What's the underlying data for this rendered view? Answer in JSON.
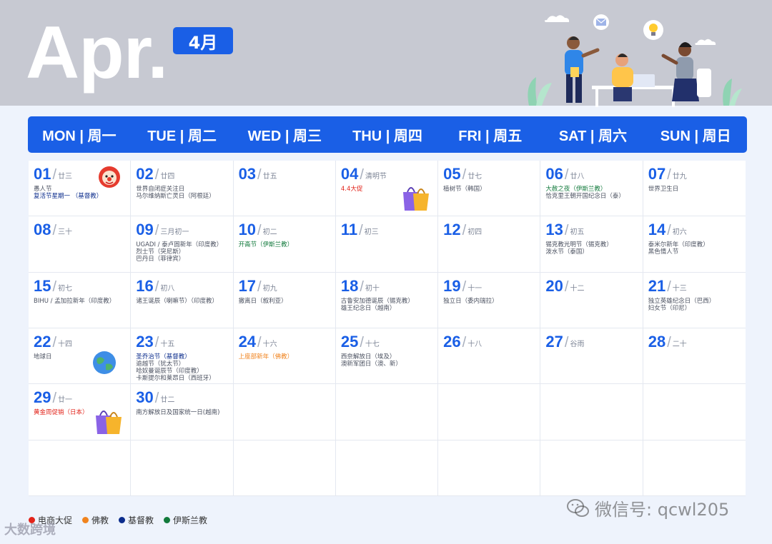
{
  "header": {
    "month_en": "Apr.",
    "month_cn": "4月"
  },
  "weekdays": [
    "MON | 周一",
    "TUE | 周二",
    "WED | 周三",
    "THU | 周四",
    "FRI | 周五",
    "SAT | 周六",
    "SUN | 周日"
  ],
  "days": [
    {
      "num": "01",
      "lunar": "廿三",
      "events": [
        {
          "t": "愚人节",
          "c": ""
        },
        {
          "t": "复活节星期一 （基督教）",
          "c": "blue"
        }
      ],
      "deco": "clown-icon"
    },
    {
      "num": "02",
      "lunar": "廿四",
      "events": [
        {
          "t": "世界自闭症关注日",
          "c": ""
        },
        {
          "t": "马尔维纳斯亡灵日（阿根廷）",
          "c": ""
        }
      ]
    },
    {
      "num": "03",
      "lunar": "廿五",
      "events": []
    },
    {
      "num": "04",
      "lunar": "清明节",
      "events": [
        {
          "t": "4.4大促",
          "c": "red"
        }
      ],
      "deco": "shopping-bag-icon"
    },
    {
      "num": "05",
      "lunar": "廿七",
      "events": [
        {
          "t": "植树节（韩国）",
          "c": ""
        }
      ]
    },
    {
      "num": "06",
      "lunar": "廿八",
      "events": [
        {
          "t": "大赦之夜（伊斯兰教）",
          "c": "green"
        },
        {
          "t": "恰克里王朝开国纪念日（泰）",
          "c": ""
        }
      ]
    },
    {
      "num": "07",
      "lunar": "廿九",
      "events": [
        {
          "t": "世界卫生日",
          "c": ""
        }
      ]
    },
    {
      "num": "08",
      "lunar": "三十",
      "events": []
    },
    {
      "num": "09",
      "lunar": "三月初一",
      "events": [
        {
          "t": "UGADI / 泰卢固新年（印度教）",
          "c": ""
        },
        {
          "t": "烈士节（突尼斯）",
          "c": ""
        },
        {
          "t": "巴丹日（菲律宾）",
          "c": ""
        }
      ]
    },
    {
      "num": "10",
      "lunar": "初二",
      "events": [
        {
          "t": "开斋节（伊斯兰教）",
          "c": "green"
        }
      ]
    },
    {
      "num": "11",
      "lunar": "初三",
      "events": []
    },
    {
      "num": "12",
      "lunar": "初四",
      "events": []
    },
    {
      "num": "13",
      "lunar": "初五",
      "events": [
        {
          "t": "锡克教光明节（锡克教）",
          "c": ""
        },
        {
          "t": "泼水节（泰国）",
          "c": ""
        }
      ]
    },
    {
      "num": "14",
      "lunar": "初六",
      "events": [
        {
          "t": "泰米尔新年（印度教）",
          "c": ""
        },
        {
          "t": "黑色情人节",
          "c": ""
        }
      ]
    },
    {
      "num": "15",
      "lunar": "初七",
      "events": [
        {
          "t": "BIHU / 孟加拉新年（印度教）",
          "c": ""
        }
      ]
    },
    {
      "num": "16",
      "lunar": "初八",
      "events": [
        {
          "t": "诸王诞辰（喇嘛节）（印度教）",
          "c": ""
        }
      ]
    },
    {
      "num": "17",
      "lunar": "初九",
      "events": [
        {
          "t": "撤离日（叙利亚）",
          "c": ""
        }
      ]
    },
    {
      "num": "18",
      "lunar": "初十",
      "events": [
        {
          "t": "古鲁安加德诞辰（锡克教）",
          "c": ""
        },
        {
          "t": "雄王纪念日（越南）",
          "c": ""
        }
      ]
    },
    {
      "num": "19",
      "lunar": "十一",
      "events": [
        {
          "t": "独立日（委内瑞拉）",
          "c": ""
        }
      ]
    },
    {
      "num": "20",
      "lunar": "十二",
      "events": []
    },
    {
      "num": "21",
      "lunar": "十三",
      "events": [
        {
          "t": "独立英雄纪念日（巴西）",
          "c": ""
        },
        {
          "t": "妇女节（印尼）",
          "c": ""
        }
      ]
    },
    {
      "num": "22",
      "lunar": "十四",
      "events": [
        {
          "t": "地球日",
          "c": ""
        }
      ],
      "deco": "earth-icon"
    },
    {
      "num": "23",
      "lunar": "十五",
      "events": [
        {
          "t": "圣乔治节（基督教）",
          "c": "blue"
        },
        {
          "t": "逾越节（犹太节）",
          "c": ""
        },
        {
          "t": "哈奴曼诞辰节（印度教）",
          "c": ""
        },
        {
          "t": "卡斯提尔和莱昂日（西班牙）",
          "c": ""
        }
      ]
    },
    {
      "num": "24",
      "lunar": "十六",
      "events": [
        {
          "t": "上座部新年（佛教）",
          "c": "orange"
        }
      ]
    },
    {
      "num": "25",
      "lunar": "十七",
      "events": [
        {
          "t": "西奈解放日（埃及）",
          "c": ""
        },
        {
          "t": "澳新军团日（澳、新）",
          "c": ""
        }
      ]
    },
    {
      "num": "26",
      "lunar": "十八",
      "events": []
    },
    {
      "num": "27",
      "lunar": "谷雨",
      "events": []
    },
    {
      "num": "28",
      "lunar": "二十",
      "events": []
    },
    {
      "num": "29",
      "lunar": "廿一",
      "events": [
        {
          "t": "黄金周促销（日本）",
          "c": "red"
        }
      ],
      "deco": "shopping-bag-icon"
    },
    {
      "num": "30",
      "lunar": "廿二",
      "events": [
        {
          "t": "南方解放日及国家统一日(越南)",
          "c": ""
        }
      ]
    }
  ],
  "legend": [
    {
      "label": "电商大促",
      "color": "#e2231a"
    },
    {
      "label": "佛教",
      "color": "#f0831e"
    },
    {
      "label": "基督教",
      "color": "#0b2c8c"
    },
    {
      "label": "伊斯兰教",
      "color": "#127a3c"
    }
  ],
  "watermarks": {
    "left": "大数跨境",
    "right": "微信号: qcwl205"
  }
}
